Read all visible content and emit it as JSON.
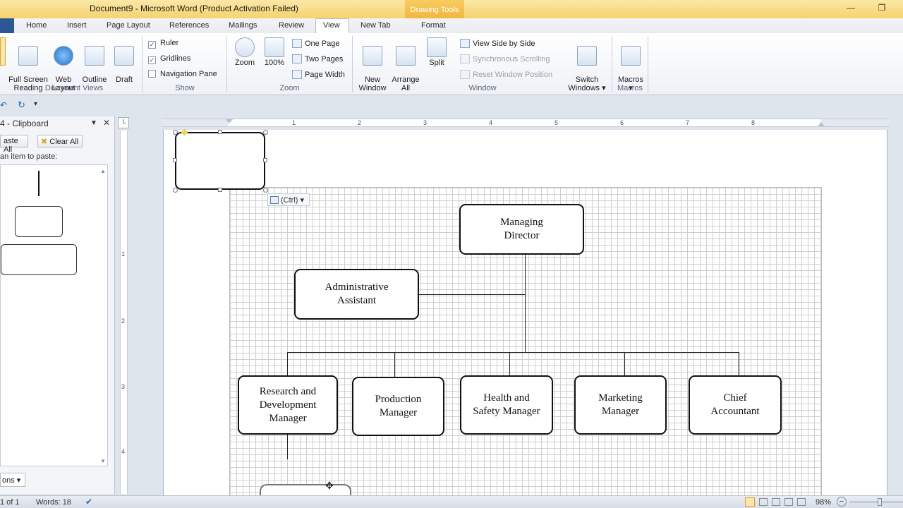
{
  "window": {
    "title": "Document9 - Microsoft Word (Product Activation Failed)",
    "contextual_tab_group": "Drawing Tools",
    "minimize": "—",
    "restore": "❐"
  },
  "tabs": [
    "Home",
    "Insert",
    "Page Layout",
    "References",
    "Mailings",
    "Review",
    "View",
    "New Tab",
    "Format"
  ],
  "ribbon": {
    "document_views": {
      "label": "Document Views",
      "buttons": [
        "Full Screen\nReading",
        "Web\nLayout",
        "Outline",
        "Draft"
      ]
    },
    "show": {
      "label": "Show",
      "ruler": "Ruler",
      "gridlines": "Gridlines",
      "navigation_pane": "Navigation Pane",
      "check_mark": "✓"
    },
    "zoom": {
      "label": "Zoom",
      "zoom": "Zoom",
      "hundred": "100%",
      "one_page": "One Page",
      "two_pages": "Two Pages",
      "page_width": "Page Width"
    },
    "window": {
      "label": "Window",
      "new_window": "New\nWindow",
      "arrange_all": "Arrange\nAll",
      "split": "Split",
      "view_side_by_side": "View Side by Side",
      "synchronous_scrolling": "Synchronous Scrolling",
      "reset_window_position": "Reset Window Position",
      "switch_windows": "Switch\nWindows ▾"
    },
    "macros": {
      "label": "Macros",
      "button": "Macros\n▾"
    }
  },
  "clipboard_pane": {
    "title": "4 - Clipboard",
    "paste_all": "aste All",
    "clear_all": "Clear All",
    "hint": "an item to paste:",
    "options": "ons ▾",
    "close": "✕",
    "dropdown": "▼"
  },
  "paste_tag": "(Ctrl) ▾",
  "ruler_numbers": [
    "1",
    "2",
    "3",
    "4",
    "5",
    "6",
    "7",
    "8"
  ],
  "vruler_numbers": [
    "1",
    "2",
    "3",
    "4"
  ],
  "org_chart": {
    "managing_director": "Managing\nDirector",
    "administrative_assistant": "Administrative\nAssistant",
    "departments": [
      "Research and\nDevelopment\nManager",
      "Production\nManager",
      "Health and\nSafety Manager",
      "Marketing\nManager",
      "Chief\nAccountant"
    ]
  },
  "statusbar": {
    "page": "1 of 1",
    "words": "Words: 18",
    "zoom": "98%",
    "zoom_minus": "−"
  }
}
